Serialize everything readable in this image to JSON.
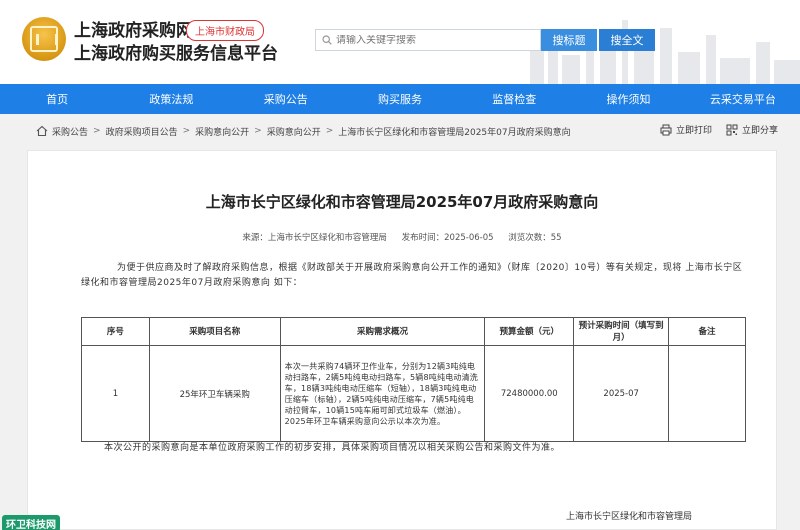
{
  "header": {
    "title_line1": "上海政府采购网",
    "title_line2": "上海政府购买服务信息平台",
    "badge": "上海市财政局",
    "search_placeholder": "请输入关键字搜索",
    "btn_search_title": "搜标题",
    "btn_search_full": "搜全文"
  },
  "nav": [
    "首页",
    "政策法规",
    "采购公告",
    "购买服务",
    "监督检查",
    "操作须知",
    "云采交易平台"
  ],
  "breadcrumb": [
    "采购公告",
    "政府采购项目公告",
    "采购意向公开",
    "采购意向公开",
    "上海市长宁区绿化和市容管理局2025年07月政府采购意向"
  ],
  "tools": {
    "print": "立即打印",
    "share": "立即分享"
  },
  "doc": {
    "title": "上海市长宁区绿化和市容管理局2025年07月政府采购意向",
    "source": "来源：上海市长宁区绿化和市容管理局",
    "date": "发布时间：2025-06-05",
    "views": "浏览次数：55",
    "intro": "为便于供应商及时了解政府采购信息，根据《财政部关于开展政府采购意向公开工作的通知》（财库〔2020〕10号）等有关规定，现将 上海市长宁区绿化和市容管理局2025年07月政府采购意向 如下：",
    "note": "本次公开的采购意向是本单位政府采购工作的初步安排，具体采购项目情况以相关采购公告和采购文件为准。",
    "signoff": "上海市长宁区绿化和市容管理局"
  },
  "table": {
    "headers": [
      "序号",
      "采购项目名称",
      "采购需求概况",
      "预算金额（元）",
      "预计采购时间（填写到月）",
      "备注"
    ],
    "rows": [
      [
        "1",
        "25年环卫车辆采购",
        "本次一共采购74辆环卫作业车，分别为12辆3吨纯电动扫路车，2辆5吨纯电动扫路车，5辆8吨纯电动清洗车，18辆3吨纯电动压缩车（短轴），18辆3吨纯电动压缩车（标轴），2辆5吨纯电动压缩车，7辆5吨纯电动拉臂车，10辆15吨车厢可卸式垃圾车（燃油）。2025年环卫车辆采购意向公示以本次为准。",
        "72480000.00",
        "2025-07",
        ""
      ]
    ]
  },
  "watermark": "环卫科技网"
}
